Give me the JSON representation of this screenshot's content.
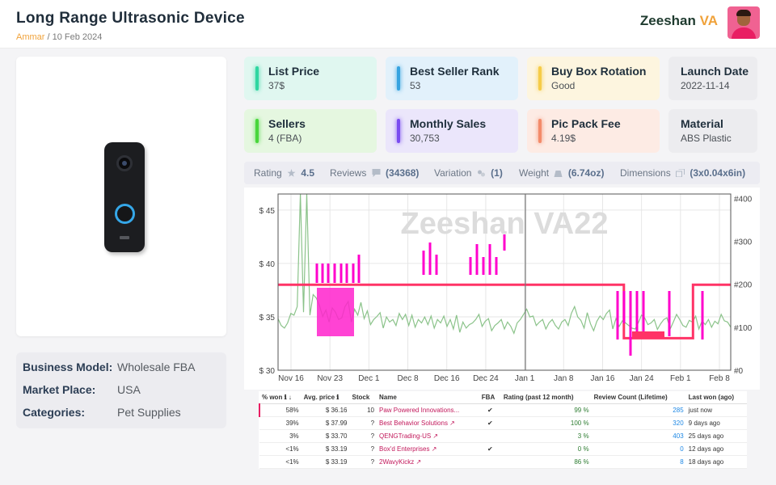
{
  "header": {
    "title": "Long Range Ultrasonic Device",
    "author": "Ammar",
    "date": "/ 10 Feb 2024",
    "user_first": "Zeeshan",
    "user_last": "VA"
  },
  "metrics": [
    {
      "label": "List Price",
      "value": "37$",
      "bg": "#e0f7f0",
      "accent": "#2fd6a1"
    },
    {
      "label": "Best Seller Rank",
      "value": "53",
      "bg": "#e2f1fb",
      "accent": "#36a3e0"
    },
    {
      "label": "Buy Box Rotation",
      "value": "Good",
      "bg": "#fdf5df",
      "accent": "#f6cc47"
    },
    {
      "label": "Launch Date",
      "value": "2022-11-14",
      "bg": "#ececef",
      "accent": ""
    },
    {
      "label": "Sellers",
      "value": "4 (FBA)",
      "bg": "#e5f7e0",
      "accent": "#48d63b"
    },
    {
      "label": "Monthly Sales",
      "value": "30,753",
      "bg": "#ebe6fb",
      "accent": "#7a4cf0"
    },
    {
      "label": "Pic Pack Fee",
      "value": "4.19$",
      "bg": "#fdebe4",
      "accent": "#f38b6a"
    },
    {
      "label": "Material",
      "value": "ABS Plastic",
      "bg": "#ececef",
      "accent": ""
    }
  ],
  "stats": {
    "rating_label": "Rating",
    "rating": "4.5",
    "reviews_label": "Reviews",
    "reviews": "(34368)",
    "variation_label": "Variation",
    "variation": "(1)",
    "weight_label": "Weight",
    "weight": "(6.74oz)",
    "dimensions_label": "Dimensions",
    "dimensions": "(3x0.04x6in)"
  },
  "info": {
    "business_model_label": "Business Model:",
    "business_model": "Wholesale FBA",
    "market_place_label": "Market Place:",
    "market_place": "USA",
    "categories_label": "Categories:",
    "categories": "Pet Supplies"
  },
  "chart_data": {
    "type": "line",
    "watermark": "Zeeshan VA22",
    "x_ticks": [
      "Nov 16",
      "Nov 23",
      "Dec 1",
      "Dec 8",
      "Dec 16",
      "Dec 24",
      "Jan 1",
      "Jan 8",
      "Jan 16",
      "Jan 24",
      "Feb 1",
      "Feb 8"
    ],
    "y_left_ticks": [
      "$ 45",
      "$ 40",
      "$ 35",
      "$ 30"
    ],
    "y_left_range": [
      30,
      46.5
    ],
    "y_right_ticks": [
      "#400",
      "#300",
      "#200",
      "#100",
      "#0"
    ],
    "y_right_range": [
      0,
      410
    ],
    "series": [
      {
        "color": "#8bc38a",
        "axis": "right",
        "values": [
          120,
          104,
          98,
          110,
          132,
          128,
          148,
          455,
          135,
          410,
          128,
          176,
          168,
          150,
          125,
          140,
          112,
          145,
          135,
          118,
          122,
          148,
          160,
          112,
          142,
          128,
          158,
          120,
          138,
          106,
          118,
          125,
          134,
          98,
          124,
          112,
          118,
          104,
          132,
          118,
          130,
          104,
          128,
          100,
          118,
          110,
          124,
          106,
          126,
          98,
          118,
          110,
          126,
          102,
          118,
          96,
          128,
          88,
          112,
          98,
          106,
          110,
          118,
          130,
          102,
          114,
          120,
          92,
          104,
          110,
          118,
          96,
          112,
          102,
          86,
          110,
          118,
          130,
          142,
          124,
          126,
          104,
          112,
          118,
          96,
          110,
          118,
          104,
          96,
          112,
          118,
          104,
          132,
          148,
          124,
          116,
          98,
          134,
          108,
          92,
          114,
          126,
          118,
          132,
          140,
          96,
          120,
          102,
          115,
          110,
          104,
          98,
          96,
          110,
          128,
          122,
          106,
          110,
          118,
          95,
          108,
          118,
          122,
          96,
          112,
          130,
          118,
          104,
          100,
          116,
          112,
          126,
          96,
          115,
          106,
          118,
          100,
          114,
          108,
          130,
          115,
          112,
          100
        ]
      },
      {
        "color": "#ff3366",
        "axis": "left",
        "values": [
          38,
          38,
          38,
          38,
          38,
          38,
          38,
          38,
          38,
          38,
          38,
          38,
          38,
          38,
          38,
          38,
          38,
          38,
          38,
          38,
          38,
          38,
          38,
          38,
          38,
          38,
          38,
          38,
          38,
          38,
          38,
          38,
          38,
          38,
          38,
          38,
          38,
          38,
          38,
          38,
          38,
          38,
          38,
          38,
          38,
          38,
          38,
          38,
          38,
          38,
          38,
          38,
          38,
          38,
          38,
          38,
          38,
          38,
          38,
          38,
          38,
          38,
          38,
          38,
          38,
          38,
          38,
          38,
          38,
          38,
          38,
          38,
          38,
          38,
          38,
          38,
          38,
          38,
          38,
          38,
          38,
          38,
          38,
          38,
          38,
          38,
          38,
          38,
          38,
          38,
          38,
          38,
          38,
          38,
          38,
          38,
          38,
          38,
          38,
          38,
          38,
          38,
          38,
          38,
          38,
          38,
          38,
          38,
          38,
          38,
          33,
          33,
          33,
          33,
          33,
          33,
          33,
          33,
          33,
          33,
          33,
          33,
          33,
          33,
          33,
          33,
          33,
          33,
          33,
          33,
          33,
          33,
          38,
          38,
          38,
          38,
          38,
          38,
          38,
          38,
          38,
          38,
          38,
          38,
          38
        ]
      }
    ]
  },
  "table": {
    "headers": [
      "% won",
      "Avg. price",
      "Stock",
      "Name",
      "FBA",
      "Rating (past 12 month)",
      "Review Count (Lifetime)",
      "Last won (ago)"
    ],
    "rows": [
      {
        "won": "58%",
        "price": "$ 36.16",
        "stock": "10",
        "name": "Paw Powered Innovations...",
        "fba": "✔",
        "rating": "99 %",
        "count": "285",
        "last": "just now"
      },
      {
        "won": "39%",
        "price": "$ 37.99",
        "stock": "?",
        "name": "Best Behavior Solutions",
        "fba": "✔",
        "rating": "100 %",
        "count": "320",
        "last": "9 days ago"
      },
      {
        "won": "3%",
        "price": "$ 33.70",
        "stock": "?",
        "name": "QENGTrading-US",
        "fba": "",
        "rating": "3 %",
        "count": "403",
        "last": "25 days ago"
      },
      {
        "won": "<1%",
        "price": "$ 33.19",
        "stock": "?",
        "name": "Box'd Enterprises",
        "fba": "✔",
        "rating": "0 %",
        "count": "0",
        "last": "12 days ago"
      },
      {
        "won": "<1%",
        "price": "$ 33.19",
        "stock": "?",
        "name": "2WavyKickz",
        "fba": "",
        "rating": "86 %",
        "count": "8",
        "last": "18 days ago"
      }
    ]
  }
}
